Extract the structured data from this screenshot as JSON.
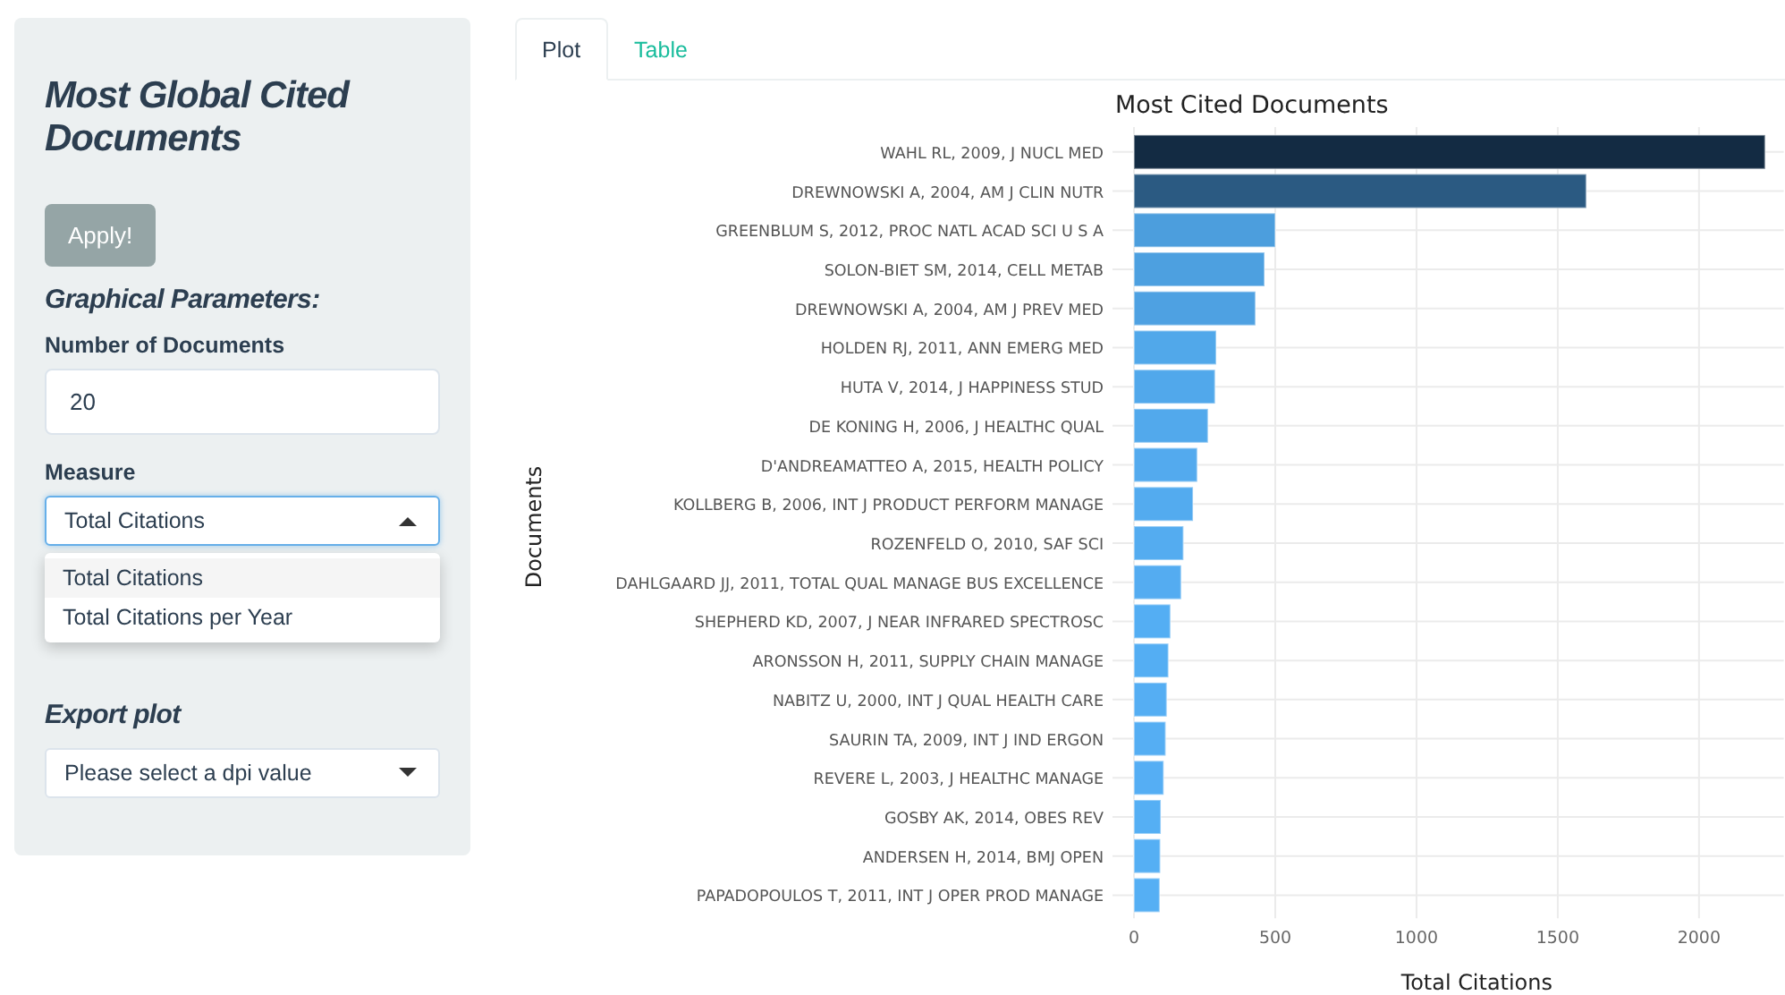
{
  "sidebar": {
    "title": "Most Global Cited Documents",
    "apply_button": "Apply!",
    "section_title": "Graphical Parameters:",
    "number_field": {
      "label": "Number of Documents",
      "value": "20"
    },
    "measure_select": {
      "label": "Measure",
      "value": "Total Citations",
      "expanded": true,
      "options": [
        {
          "label": "Total Citations",
          "selected": true
        },
        {
          "label": "Total Citations per Year",
          "selected": false
        }
      ]
    },
    "export_title": "Export plot",
    "dpi_select": {
      "placeholder": "Please select a dpi value",
      "expanded": false
    }
  },
  "tabs": [
    {
      "label": "Plot",
      "selected": true
    },
    {
      "label": "Table",
      "selected": false
    }
  ],
  "chart_data": {
    "type": "bar",
    "orientation": "horizontal",
    "title": "Most Cited Documents",
    "xlabel": "Total Citations",
    "ylabel": "Documents",
    "categories": [
      "WAHL RL, 2009, J NUCL MED",
      "DREWNOWSKI A, 2004, AM J CLIN NUTR",
      "GREENBLUM S, 2012, PROC NATL ACAD SCI U S A",
      "SOLON-BIET SM, 2014, CELL METAB",
      "DREWNOWSKI A, 2004, AM J PREV MED",
      "HOLDEN RJ, 2011, ANN EMERG MED",
      "HUTA V, 2014, J HAPPINESS STUD",
      "DE KONING H, 2006, J HEALTHC QUAL",
      "D'ANDREAMATTEO A, 2015, HEALTH POLICY",
      "KOLLBERG B, 2006, INT J PRODUCT PERFORM MANAGE",
      "ROZENFELD O, 2010, SAF SCI",
      "DAHLGAARD JJ, 2011, TOTAL QUAL MANAGE BUS EXCELLENCE",
      "SHEPHERD KD, 2007, J NEAR INFRARED SPECTROSC",
      "ARONSSON H, 2011, SUPPLY CHAIN MANAGE",
      "NABITZ U, 2000, INT J QUAL HEALTH CARE",
      "SAURIN TA, 2009, INT J IND ERGON",
      "REVERE L, 2003, J HEALTHC MANAGE",
      "GOSBY AK, 2014, OBES REV",
      "ANDERSEN H, 2014, BMJ OPEN",
      "PAPADOPOULOS T, 2011, INT J OPER PROD MANAGE"
    ],
    "grid": true,
    "series": [
      {
        "values": [
          2234,
          1601,
          500,
          462,
          430,
          291,
          287,
          262,
          224,
          209,
          175,
          167,
          129,
          122,
          116,
          112,
          105,
          95,
          93,
          91
        ]
      }
    ],
    "xlim": [
      0,
      2300
    ],
    "xticks": [
      0,
      500,
      1000,
      1500,
      2000
    ]
  }
}
